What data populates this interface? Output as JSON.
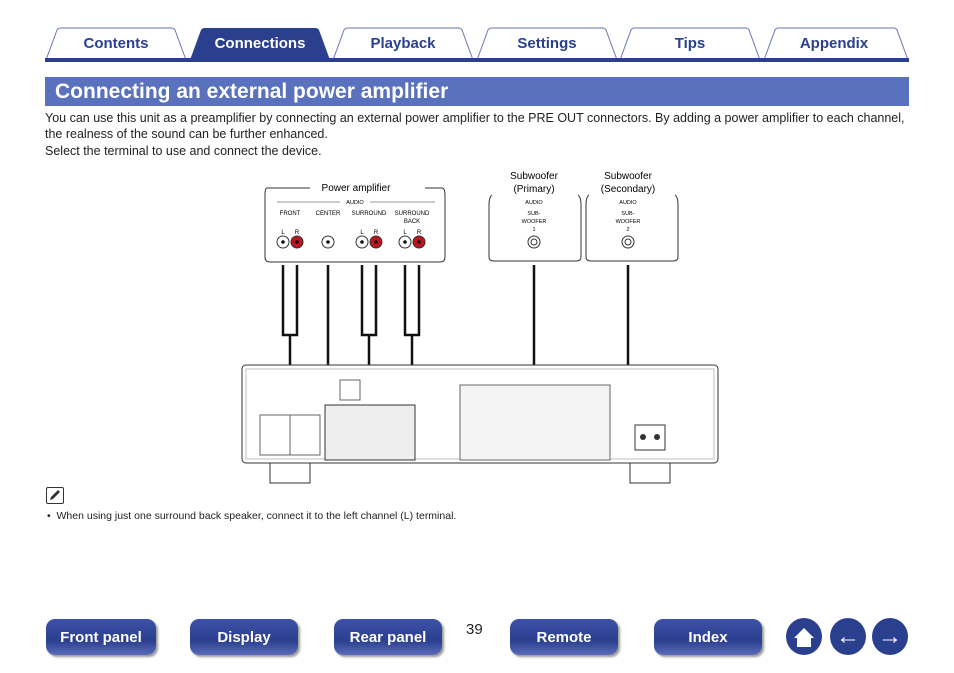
{
  "tabs": [
    {
      "label": "Contents"
    },
    {
      "label": "Connections",
      "active": true
    },
    {
      "label": "Playback"
    },
    {
      "label": "Settings"
    },
    {
      "label": "Tips"
    },
    {
      "label": "Appendix"
    }
  ],
  "title": "Connecting an external power amplifier",
  "intro": "You can use this unit as a preamplifier by connecting an external power amplifier to the PRE OUT connectors. By adding a power amplifier to each channel, the realness of the sound can be further enhanced.",
  "instruction": "Select the terminal to use and connect the device.",
  "diagram": {
    "power_amp": {
      "label": "Power amplifier",
      "audio": "AUDIO",
      "front": "FRONT",
      "center": "CENTER",
      "surround": "SURROUND",
      "surround_back_1": "SURROUND",
      "surround_back_2": "BACK",
      "l": "L",
      "r": "R"
    },
    "sub1": {
      "label_1": "Subwoofer",
      "label_2": "(Primary)",
      "audio": "AUDIO",
      "t1": "SUB-",
      "t2": "WOOFER",
      "t3": "1"
    },
    "sub2": {
      "label_1": "Subwoofer",
      "label_2": "(Secondary)",
      "audio": "AUDIO",
      "t1": "SUB-",
      "t2": "WOOFER",
      "t3": "2"
    }
  },
  "note_icon": "pencil-note-icon",
  "note": "When using just one surround back speaker, connect it to the left channel (L) terminal.",
  "page_number": "39",
  "nav": {
    "front_panel": "Front panel",
    "display": "Display",
    "rear_panel": "Rear panel",
    "remote": "Remote",
    "index": "Index"
  },
  "colors": {
    "brand": "#2b3f8f",
    "title_bar": "#5a72bd",
    "right_channel": "#c0141c"
  }
}
